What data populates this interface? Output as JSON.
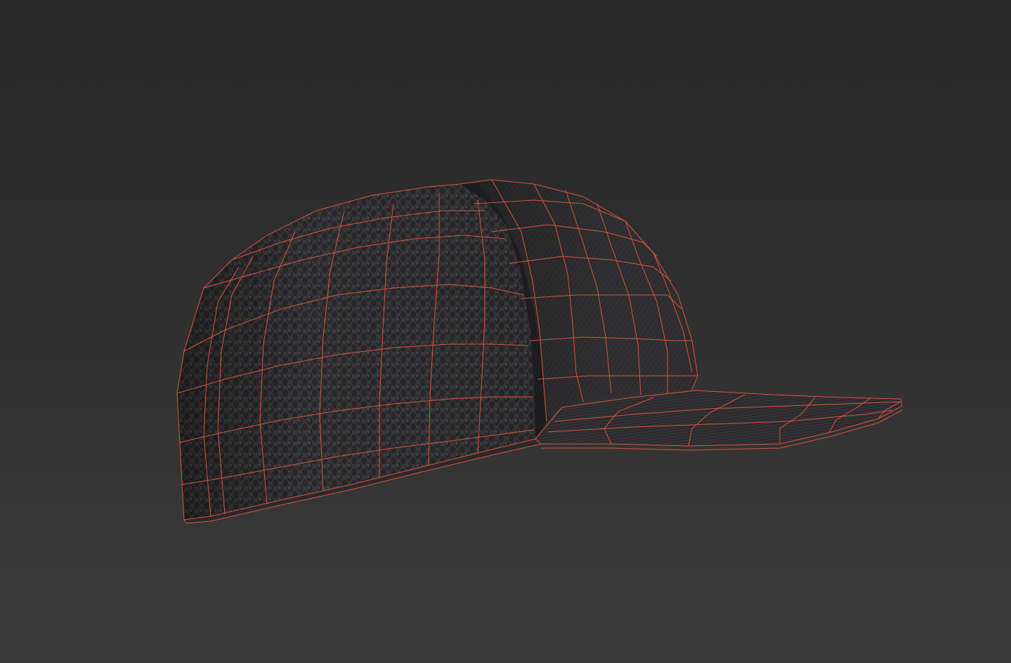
{
  "viewport": {
    "background_top": "#272727",
    "background_bottom": "#3a3a3a",
    "wireframe_color": "#e0553c"
  },
  "model": {
    "name": "",
    "mesh_colors": {
      "mesh_fabric": "#3b3a3c",
      "mesh_fabric_dark": "#2e2d2f",
      "solid_fabric": "#232224",
      "brim_top": "#2b2a2c",
      "brim_edge": "#333234"
    }
  }
}
